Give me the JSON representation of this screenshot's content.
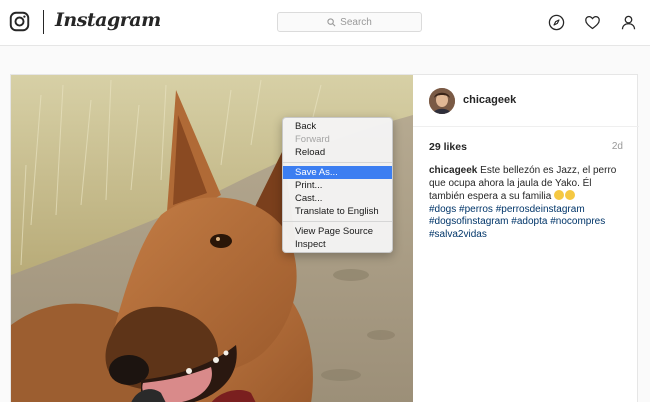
{
  "app": {
    "wordmark": "Instagram"
  },
  "search": {
    "placeholder": "Search",
    "icon": "search-icon"
  },
  "nav_icons": [
    "compass-icon",
    "heart-icon",
    "user-icon"
  ],
  "post": {
    "author": "chicageek",
    "likes": "29 likes",
    "age": "2d",
    "caption": {
      "username": "chicageek",
      "text": "Este bellezón es Jazz, el perro que ocupa ahora la jaula de Yako. Él también espera a su familia",
      "tags": "#dogs #perros #perrosdeinstagram #dogsofinstagram #adopta #nocompres #salva2vidas"
    }
  },
  "context_menu": {
    "groups": [
      [
        {
          "label": "Back",
          "state": "normal"
        },
        {
          "label": "Forward",
          "state": "disabled"
        },
        {
          "label": "Reload",
          "state": "normal"
        }
      ],
      [
        {
          "label": "Save As...",
          "state": "active"
        },
        {
          "label": "Print...",
          "state": "normal"
        },
        {
          "label": "Cast...",
          "state": "normal"
        },
        {
          "label": "Translate to English",
          "state": "normal"
        }
      ],
      [
        {
          "label": "View Page Source",
          "state": "normal"
        },
        {
          "label": "Inspect",
          "state": "normal"
        }
      ]
    ]
  },
  "colors": {
    "highlight": "#3c7ef1",
    "hashtag": "#003569",
    "text": "#262626",
    "muted": "#999999"
  }
}
